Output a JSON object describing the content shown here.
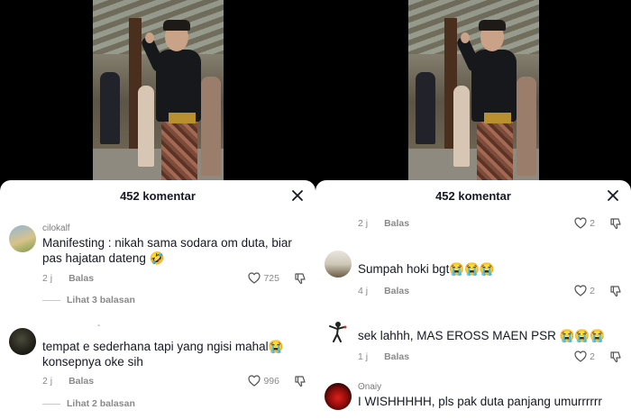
{
  "header": {
    "title": "452 komentar"
  },
  "left": {
    "comments": [
      {
        "username": "cilokalf",
        "text": "Manifesting : nikah sama sodara om duta, biar pas hajatan dateng 🤣",
        "time": "2 j",
        "reply_label": "Balas",
        "likes": "725",
        "view_replies": "Lihat 3 balasan"
      },
      {
        "username": "-",
        "text": "tempat e sederhana tapi yang ngisi mahal😭 konsepnya oke sih",
        "time": "2 j",
        "reply_label": "Balas",
        "likes": "996",
        "view_replies": "Lihat 2 balasan"
      }
    ]
  },
  "right": {
    "top_meta": {
      "time": "2 j",
      "reply_label": "Balas",
      "likes": "2"
    },
    "comments": [
      {
        "text": "Sumpah hoki bgt😭😭😭",
        "time": "4 j",
        "reply_label": "Balas",
        "likes": "2"
      },
      {
        "text": "sek lahhh, MAS EROSS MAEN PSR 😭😭😭",
        "time": "1 j",
        "reply_label": "Balas",
        "likes": "2"
      },
      {
        "username": "ʘnaiy",
        "text": "I WISHHHHH, pls pak duta panjang umurrrrrr"
      }
    ]
  },
  "icons": [
    "close-icon",
    "heart-icon",
    "dislike-icon"
  ],
  "colors": {
    "text": "#161823",
    "muted": "#8a8a8a",
    "sheet": "#ffffff",
    "backdrop": "#000000"
  }
}
